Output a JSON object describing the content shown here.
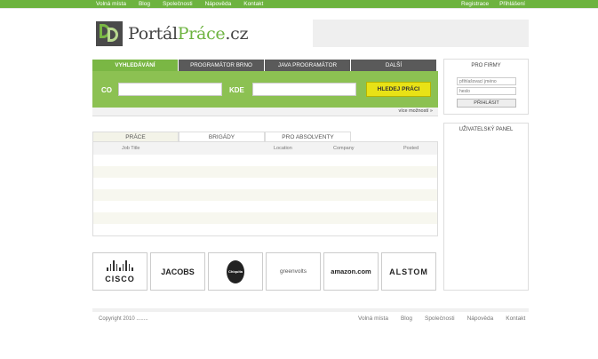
{
  "topnav": {
    "left": [
      "Volná místa",
      "Blog",
      "Společnosti",
      "Nápověda",
      "Kontakt"
    ],
    "right": [
      "Registrace",
      "Přihlášení"
    ]
  },
  "logo": {
    "part1": "Portál",
    "part2": "Práce",
    "part3": ".cz"
  },
  "search": {
    "tabs": [
      "VYHLEDÁVÁNÍ",
      "PROGRAMÁTOR BRNO",
      "JAVA PROGRAMÁTOR",
      "DALŠÍ"
    ],
    "co_label": "CO",
    "kde_label": "KDE",
    "co_value": "",
    "kde_value": "",
    "button": "HLEDEJ PRÁCI",
    "more": "více možností »"
  },
  "firms": {
    "title": "PRO FIRMY",
    "username_placeholder": "přihlašovací jméno",
    "password_placeholder": "heslo",
    "login_button": "PŘIHLÁSIT"
  },
  "jobs": {
    "tabs": [
      "PRÁCE",
      "BRIGÁDY",
      "PRO ABSOLVENTY"
    ],
    "columns": [
      "Job Title",
      "Location",
      "Company",
      "Posted"
    ],
    "rows": []
  },
  "user_panel": {
    "title": "UŽIVATELSKÝ PANEL"
  },
  "partners": {
    "cisco": "CISCO",
    "jacobs": "JACOBS",
    "chiquita": "Chiquita",
    "greenvolts": "greenvolts",
    "amazon": "amazon.com",
    "alstom": "ALSTOM"
  },
  "footer": {
    "copyright": "Copyright 2010 ........",
    "nav": [
      "Volná místa",
      "Blog",
      "Společnosti",
      "Nápověda",
      "Kontakt"
    ]
  },
  "colors": {
    "brand_green": "#6db33f",
    "tab_dark": "#5a5a5a",
    "button_yellow": "#e8e216"
  }
}
